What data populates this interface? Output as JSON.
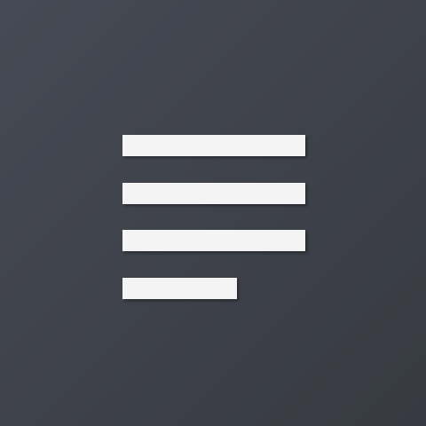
{
  "app_icon": {
    "icon": "text-lines-icon",
    "colors": {
      "background_start": "#464a54",
      "background_end": "#373a41",
      "lines": "#f4f4f4"
    }
  }
}
